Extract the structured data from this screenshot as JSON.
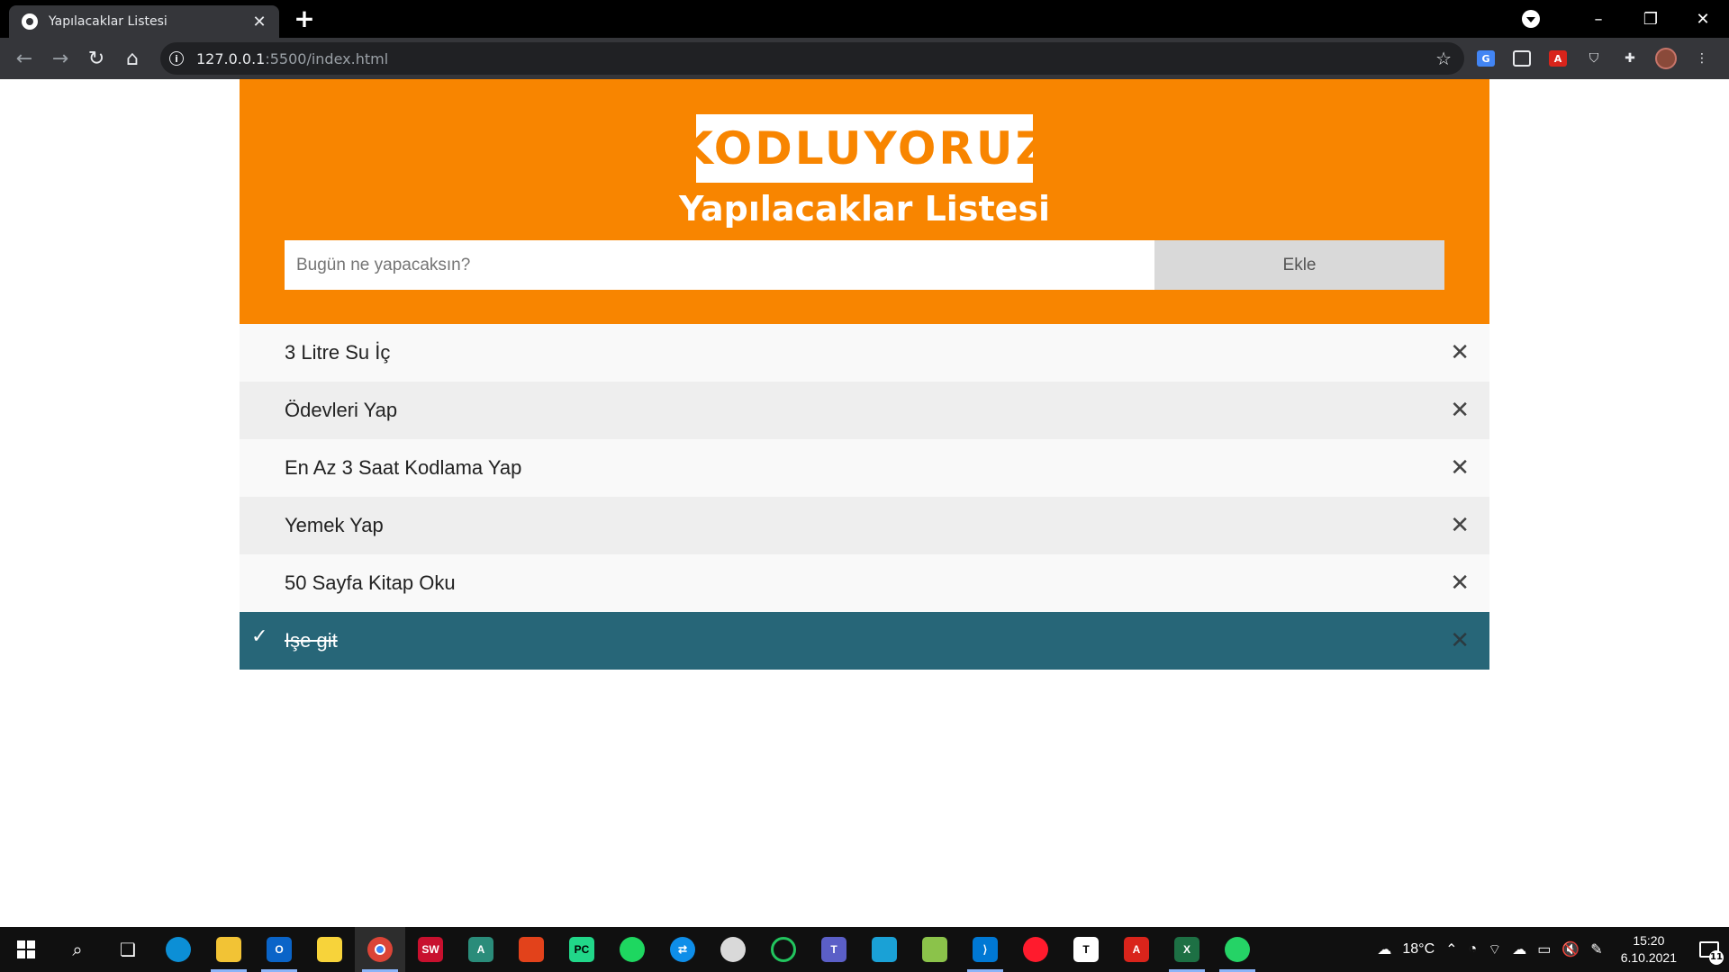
{
  "browser": {
    "tab_title": "Yapılacaklar Listesi",
    "url_host": "127.0.0.1",
    "url_rest": ":5500/index.html"
  },
  "app": {
    "logo_text": "KODLUYORUZ",
    "title": "Yapılacaklar Listesi",
    "input_placeholder": "Bugün ne yapacaksın?",
    "add_button_label": "Ekle",
    "items": [
      {
        "text": "3 Litre Su İç",
        "checked": false
      },
      {
        "text": "Ödevleri Yap",
        "checked": false
      },
      {
        "text": "En Az 3 Saat Kodlama Yap",
        "checked": false
      },
      {
        "text": "Yemek Yap",
        "checked": false
      },
      {
        "text": "50 Sayfa Kitap Oku",
        "checked": false
      },
      {
        "text": "Işe git",
        "checked": true
      }
    ],
    "colors": {
      "header": "#f88500",
      "checked_item": "#276678"
    }
  },
  "taskbar": {
    "weather_temp": "18°C",
    "time": "15:20",
    "date": "6.10.2021",
    "notification_count": "11"
  }
}
